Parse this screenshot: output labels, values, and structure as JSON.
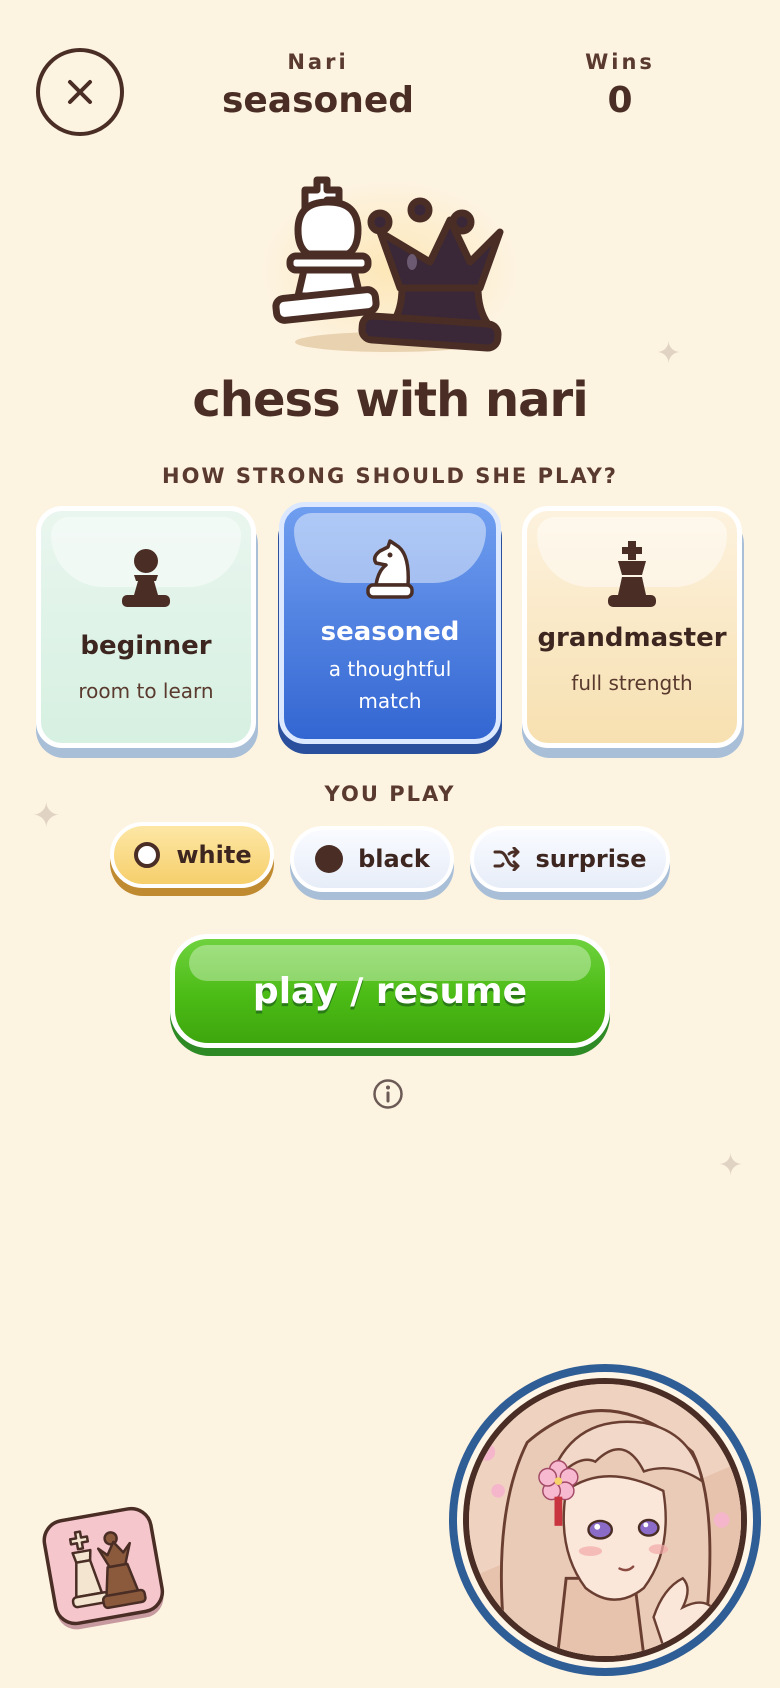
{
  "header": {
    "opponent_label": "Nari",
    "opponent_level": "seasoned",
    "wins_label": "Wins",
    "wins_value": "0"
  },
  "title": "chess with nari",
  "difficulty": {
    "prompt": "HOW STRONG SHOULD SHE PLAY?",
    "selected": "seasoned",
    "options": [
      {
        "title": "beginner",
        "subtitle": "room to learn",
        "icon": "pawn-icon"
      },
      {
        "title": "seasoned",
        "subtitle": "a thoughtful match",
        "icon": "knight-icon"
      },
      {
        "title": "grandmaster",
        "subtitle": "full strength",
        "icon": "king-icon"
      }
    ]
  },
  "side": {
    "prompt": "YOU PLAY",
    "selected": "white",
    "options": [
      {
        "label": "white",
        "icon": "white-circle-icon"
      },
      {
        "label": "black",
        "icon": "black-circle-icon"
      },
      {
        "label": "surprise",
        "icon": "shuffle-icon"
      }
    ]
  },
  "play_button": {
    "label": "play / resume"
  },
  "colors": {
    "background": "#fdf3e1",
    "text": "#4a2e25",
    "selected_card": "#3f73dc",
    "play_green": "#4bbb15",
    "selected_pill": "#f6cf6c",
    "avatar_ring": "#2f5d95"
  }
}
